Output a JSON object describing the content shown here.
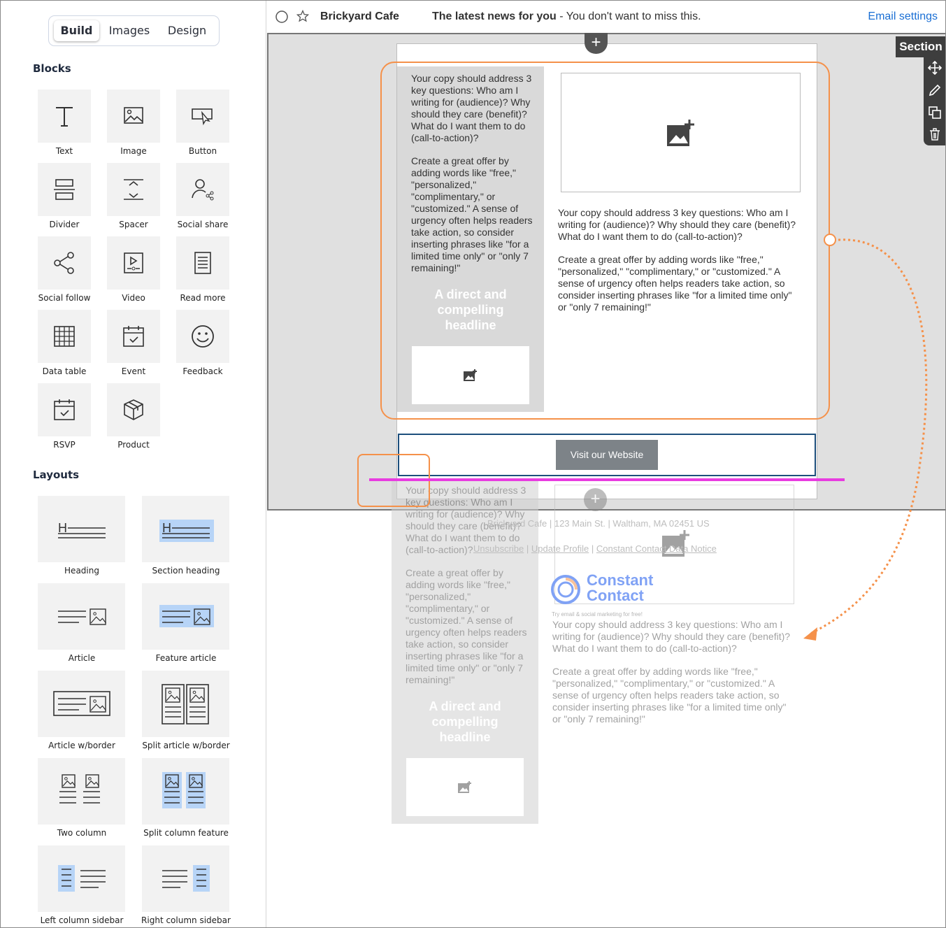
{
  "tabs": [
    "Build",
    "Images",
    "Design"
  ],
  "sections": {
    "blocks": "Blocks",
    "layouts": "Layouts"
  },
  "blocks": [
    {
      "label": "Text",
      "icon": "text-icon"
    },
    {
      "label": "Image",
      "icon": "image-icon"
    },
    {
      "label": "Button",
      "icon": "button-icon"
    },
    {
      "label": "Divider",
      "icon": "divider-icon"
    },
    {
      "label": "Spacer",
      "icon": "spacer-icon"
    },
    {
      "label": "Social share",
      "icon": "social-share-icon"
    },
    {
      "label": "Social follow",
      "icon": "social-follow-icon"
    },
    {
      "label": "Video",
      "icon": "video-icon"
    },
    {
      "label": "Read more",
      "icon": "read-more-icon"
    },
    {
      "label": "Data table",
      "icon": "data-table-icon"
    },
    {
      "label": "Event",
      "icon": "event-icon"
    },
    {
      "label": "Feedback",
      "icon": "feedback-icon"
    },
    {
      "label": "RSVP",
      "icon": "rsvp-icon"
    },
    {
      "label": "Product",
      "icon": "product-icon"
    }
  ],
  "layouts": [
    {
      "label": "Heading"
    },
    {
      "label": "Section heading"
    },
    {
      "label": "Article"
    },
    {
      "label": "Feature article"
    },
    {
      "label": "Article w/border"
    },
    {
      "label": "Split article w/border"
    },
    {
      "label": "Two column"
    },
    {
      "label": "Split column feature"
    },
    {
      "label": "Left column sidebar"
    },
    {
      "label": "Right column sidebar"
    }
  ],
  "header": {
    "sender": "Brickyard Cafe",
    "subject": "The latest news for you",
    "preheader": " - You don't want to miss this.",
    "email_settings": "Email settings"
  },
  "section_toolbar": {
    "label": "Section",
    "tools": [
      "move-icon",
      "edit-icon",
      "duplicate-icon",
      "delete-icon"
    ]
  },
  "content": {
    "left_copy_1": "Your copy should address 3 key questions: Who am I writing for (audience)? Why should they care (benefit)? What do I want them to do (call-to-action)?",
    "left_copy_2": "Create a great offer by adding words like \"free,\" \"personalized,\" \"complimentary,\" or \"customized.\" A sense of urgency often helps readers take action, so consider inserting phrases like \"for a limited time only\" or \"only 7 remaining!\"",
    "headline": "A direct and compelling headline",
    "right_copy_1": "Your copy should address 3 key questions: Who am I writing for (audience)? Why should they care (benefit)? What do I want them to do (call-to-action)?",
    "right_copy_2": "Create a great offer by adding words like \"free,\" \"personalized,\" \"complimentary,\" or \"customized.\" A sense of urgency often helps readers take action, so consider inserting phrases like \"for a limited time only\" or \"only 7 remaining!\"",
    "button": "Visit our Website"
  },
  "footer": {
    "address": "Brickyard Cafe | 123 Main St. | Waltham, MA 02451 US",
    "link1": "Unsubscribe",
    "link2": "Update Profile",
    "link3": "Constant Contact Data Notice",
    "logo1": "Constant",
    "logo2": "Contact",
    "tagline": "Try email & social marketing for free!"
  },
  "colors": {
    "accent": "#f5914a",
    "magenta": "#e83ce0",
    "link": "#1a6fd4",
    "button": "#7d8388",
    "headline": "#ffffff"
  }
}
